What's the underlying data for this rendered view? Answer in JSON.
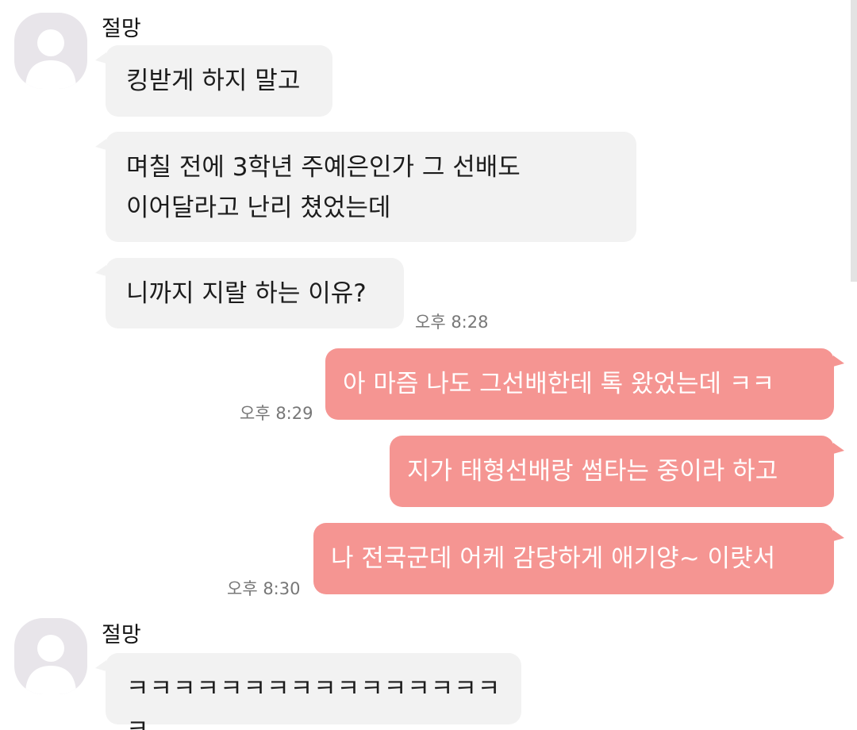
{
  "conversation": {
    "partner_name": "절망",
    "messages": [
      {
        "text": "킹받게 하지 말고"
      },
      {
        "line1": "며칠 전에 3학년 주예은인가 그 선배도",
        "line2": "이어달라고 난리 쳤었는데"
      },
      {
        "text": "니까지 지랄 하는 이유?",
        "time": "오후 8:28"
      },
      {
        "text": "아 마즘 나도 그선배한테 톡 왔었는데 ㅋㅋ",
        "time": "오후 8:29"
      },
      {
        "text": "지가 태형선배랑 썸타는 중이라 하고"
      },
      {
        "text": "나 전국군데 어케 감당하게 애기양~ 이럇서",
        "time": "오후 8:30"
      },
      {
        "text": "ㅋㅋㅋㅋㅋㅋㅋㅋㅋㅋㅋㅋㅋㅋㅋㅋㅋ"
      }
    ]
  },
  "colors": {
    "incoming_bubble": "#f2f2f2",
    "outgoing_bubble": "#f59592",
    "avatar_bg": "#e8e5ea",
    "timestamp": "#777777"
  },
  "icons": {
    "avatar": "default-profile-icon"
  }
}
